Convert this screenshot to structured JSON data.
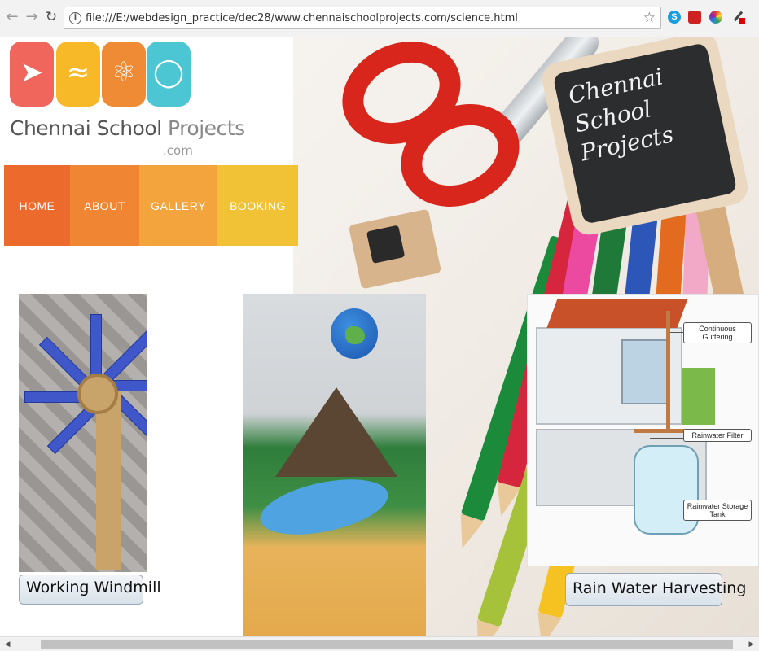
{
  "browser": {
    "url": "file:///E:/webdesign_practice/dec28/www.chennaischoolprojects.com/science.html"
  },
  "logo": {
    "name_part1": "Chennai School ",
    "name_part2": "Projects",
    "domain_suffix": ".com"
  },
  "nav": {
    "items": [
      {
        "label": "HOME",
        "color": "#ec6a2c"
      },
      {
        "label": "ABOUT",
        "color": "#f08634"
      },
      {
        "label": "GALLERY",
        "color": "#f3a43c"
      },
      {
        "label": "BOOKING",
        "color": "#f1c236"
      }
    ]
  },
  "hero": {
    "chalkboard_lines": [
      "Chennai",
      "School",
      "Projects"
    ]
  },
  "projects": [
    {
      "caption": "Working Windmill",
      "icon": "windmill-photo"
    },
    {
      "caption": "",
      "icon": "volcano-globe-model-photo"
    },
    {
      "caption": "Rain Water Harvesting",
      "icon": "rainwater-diagram"
    }
  ],
  "rainwater_labels": [
    "Continuous Guttering",
    "Rainwater Filter",
    "Rainwater Storage Tank"
  ],
  "colors": {
    "nav_home": "#ec6a2c",
    "nav_about": "#f08634",
    "nav_gallery": "#f3a43c",
    "nav_booking": "#f1c236"
  }
}
